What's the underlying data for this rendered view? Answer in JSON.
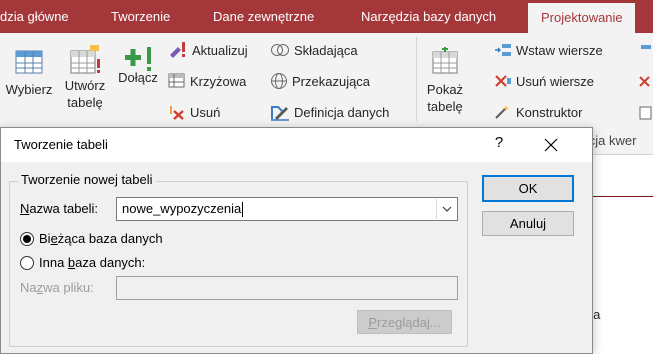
{
  "ribbon": {
    "tabs": [
      "dzia główne",
      "Tworzenie",
      "Dane zewnętrzne",
      "Narzędzia bazy danych",
      "Projektowanie"
    ],
    "active_tab": "Projektowanie",
    "buttons": {
      "wybierz": "Wybierz",
      "utworz_tabele_1": "Utwórz",
      "utworz_tabele_2": "tabelę",
      "dolacz": "Dołącz",
      "aktualizuj": "Aktualizuj",
      "krzyzowa": "Krzyżowa",
      "usun": "Usuń",
      "skladajaca": "Składająca",
      "przekazujaca": "Przekazująca",
      "definicja_danych": "Definicja danych",
      "pokaz_tabele_1": "Pokaż",
      "pokaz_tabele_2": "tabelę",
      "wstaw_wiersze": "Wstaw wiersze",
      "usun_wiersze": "Usuń wiersze",
      "konstruktor": "Konstruktor"
    },
    "group_label_partial": "uracja kwer"
  },
  "background": {
    "panel_text": "nia"
  },
  "dialog": {
    "title": "Tworzenie tabeli",
    "help": "?",
    "group_title": "Tworzenie nowej tabeli",
    "table_name_label_pre": "",
    "table_name_label_ul": "N",
    "table_name_label_post": "azwa tabeli:",
    "table_name_value": "nowe_wypozyczenia",
    "radio_current_pre": "Bi",
    "radio_current_ul": "e",
    "radio_current_post": "żąca baza danych",
    "radio_other_pre": "Inna ",
    "radio_other_ul": "b",
    "radio_other_post": "aza danych:",
    "file_name_pre": "Na",
    "file_name_ul": "z",
    "file_name_post": "wa pliku:",
    "file_name_value": "",
    "browse_pre": "",
    "browse_ul": "P",
    "browse_post": "rzeglądaj...",
    "ok": "OK",
    "cancel": "Anuluj",
    "selected_option": "current_database"
  },
  "colors": {
    "accent": "#a4373a",
    "focus": "#0078d7"
  }
}
